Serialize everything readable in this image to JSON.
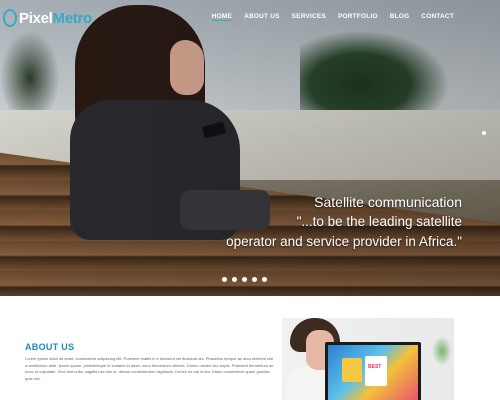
{
  "brand": {
    "name_part1": "Pixel",
    "name_part2": "Metro"
  },
  "nav": {
    "items": [
      {
        "label": "HOME",
        "active": true
      },
      {
        "label": "ABOUT US",
        "active": false
      },
      {
        "label": "SERVICES",
        "active": false
      },
      {
        "label": "PORTFOLIO",
        "active": false
      },
      {
        "label": "BLOG",
        "active": false
      },
      {
        "label": "CONTACT",
        "active": false
      }
    ]
  },
  "hero": {
    "title": "Satellite communication",
    "quote_line1": "\"...to be the leading satellite",
    "quote_line2": "operator and service provider in Africa.\"",
    "slide_count": 5
  },
  "about": {
    "title": "ABOUT US",
    "body": "Lorem ipsum dolor sit amet, consectetur adipiscing elit. Praesent mattis in e tincidunt vel tincidunt dui. Phasellus tempor ac arcu eleifend nisi a vestibulum ante. Ipsum ipsum, pellentesque et sodales id amet, nunc fermentum ultrices. Donec ornare nec turpis. Praesent fermentum ac nunc ut vulputate. Sed velit nulla, sagittis nec nisi id, dictum condimentum dignissim. Donec mi nisi id leo. Etiam consectetur quam gravida quis nisi."
  },
  "photo": {
    "screen_label": "BEST"
  },
  "colors": {
    "accent": "#36a9c7",
    "about_title": "#1f8bb0",
    "text_muted": "#666666"
  }
}
